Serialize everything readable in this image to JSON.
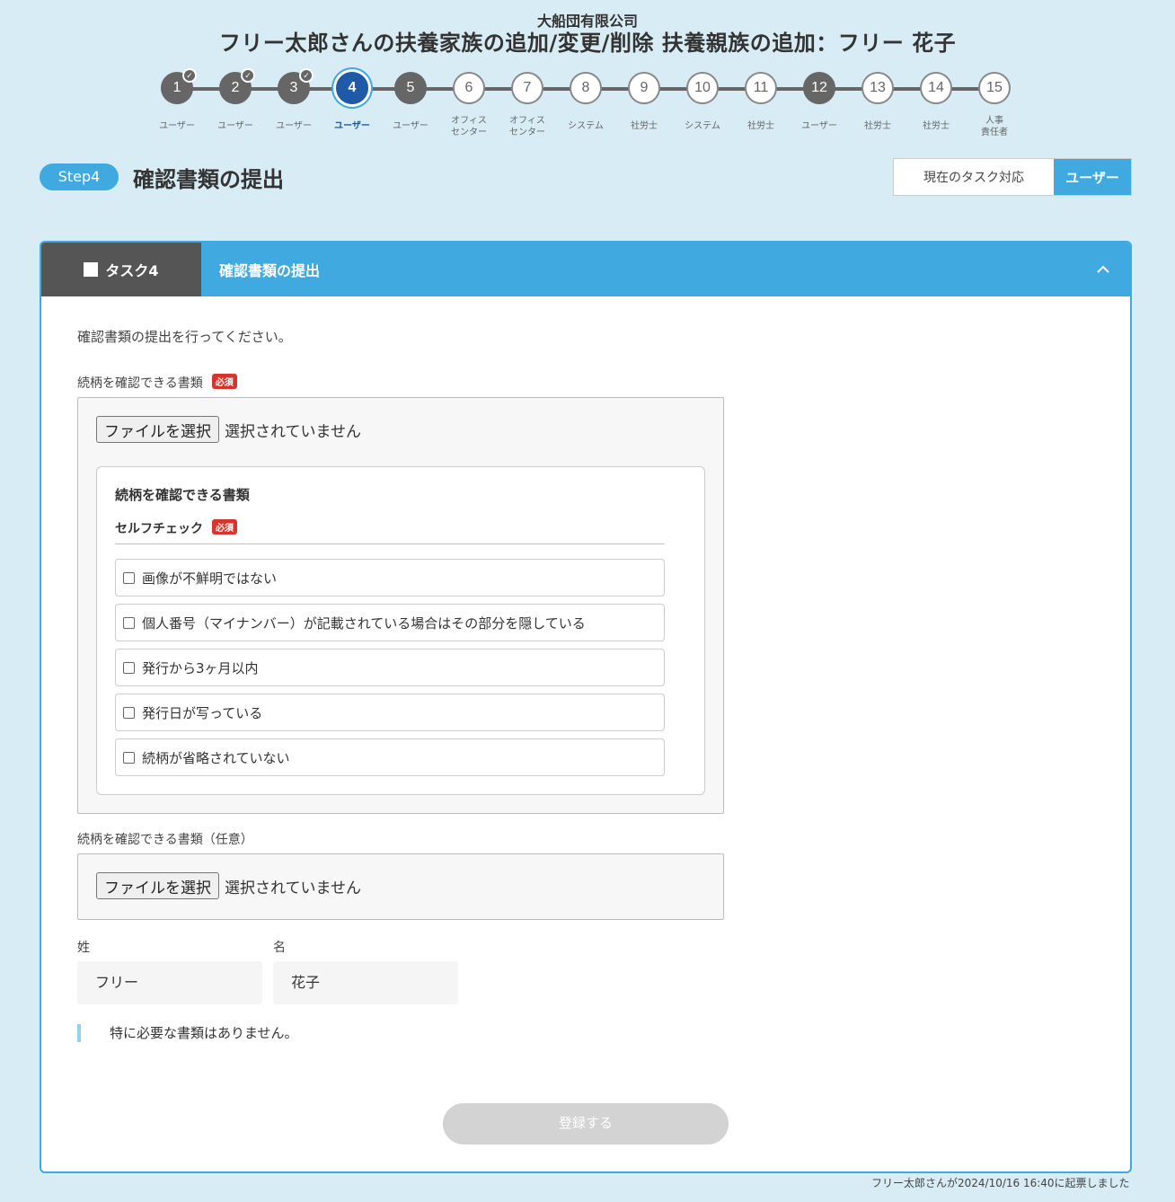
{
  "header": {
    "company": "大船団有限公司",
    "title": "フリー太郎さんの扶養家族の追加/変更/削除 扶養親族の追加：フリー 花子"
  },
  "steps": [
    {
      "num": "1",
      "label": "ユーザー",
      "state": "done"
    },
    {
      "num": "2",
      "label": "ユーザー",
      "state": "done"
    },
    {
      "num": "3",
      "label": "ユーザー",
      "state": "done"
    },
    {
      "num": "4",
      "label": "ユーザー",
      "state": "current"
    },
    {
      "num": "5",
      "label": "ユーザー",
      "state": "filled"
    },
    {
      "num": "6",
      "label": "オフィス\nセンター",
      "state": "todo"
    },
    {
      "num": "7",
      "label": "オフィス\nセンター",
      "state": "todo"
    },
    {
      "num": "8",
      "label": "システム",
      "state": "todo"
    },
    {
      "num": "9",
      "label": "社労士",
      "state": "todo"
    },
    {
      "num": "10",
      "label": "システム",
      "state": "todo"
    },
    {
      "num": "11",
      "label": "社労士",
      "state": "todo"
    },
    {
      "num": "12",
      "label": "ユーザー",
      "state": "filled"
    },
    {
      "num": "13",
      "label": "社労士",
      "state": "todo"
    },
    {
      "num": "14",
      "label": "社労士",
      "state": "todo"
    },
    {
      "num": "15",
      "label": "人事\n責任者",
      "state": "todo"
    }
  ],
  "step_heading": {
    "pill": "Step4",
    "title": "確認書類の提出"
  },
  "current_task": {
    "label": "現在のタスク対応",
    "value": "ユーザー"
  },
  "task_card": {
    "tab_label": "タスク4",
    "title": "確認書類の提出",
    "intro": "確認書類の提出を行ってください。",
    "required_badge": "必須",
    "doc1_label": "続柄を確認できる書類",
    "file_button": "ファイルを選択",
    "file_status": "選択されていません",
    "self_check_title": "続柄を確認できる書類",
    "self_check_label": "セルフチェック",
    "checks": [
      "画像が不鮮明ではない",
      "個人番号（マイナンバー）が記載されている場合はその部分を隠している",
      "発行から3ヶ月以内",
      "発行日が写っている",
      "続柄が省略されていない"
    ],
    "doc2_label": "続柄を確認できる書類（任意）",
    "last_name_label": "姓",
    "first_name_label": "名",
    "last_name_value": "フリー",
    "first_name_value": "花子",
    "note": "特に必要な書類はありません。",
    "submit": "登録する"
  },
  "footer_note": "フリー太郎さんが2024/10/16 16:40に起票しました",
  "colors": {
    "background": "#d8ecf5",
    "accent": "#3fa9e0",
    "current_step": "#1e5aa8",
    "required": "#d9342b"
  }
}
